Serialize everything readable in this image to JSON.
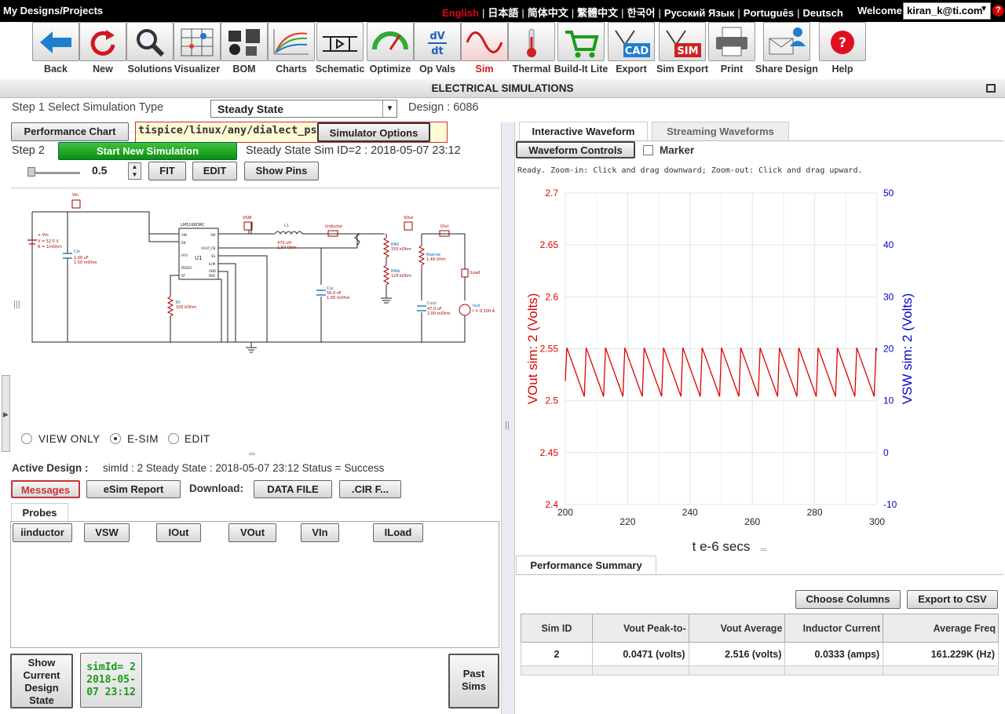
{
  "topbar": {
    "home": "My Designs/Projects",
    "languages": [
      "English",
      "日本語",
      "简体中文",
      "繁體中文",
      "한국어",
      "Русский Язык",
      "Português",
      "Deutsch"
    ],
    "welcome": "Welcome",
    "user": "kiran_k@ti.com",
    "help": "?"
  },
  "toolbar": [
    {
      "label": "Back",
      "icon": "back-arrow-icon"
    },
    {
      "label": "New",
      "icon": "refresh-icon"
    },
    {
      "label": "Solutions",
      "icon": "magnifier-icon"
    },
    {
      "label": "Visualizer",
      "icon": "visualizer-grid-icon"
    },
    {
      "label": "BOM",
      "icon": "bom-parts-icon"
    },
    {
      "label": "Charts",
      "icon": "charts-icon"
    },
    {
      "label": "Schematic",
      "icon": "schematic-icon"
    },
    {
      "label": "Optimize",
      "icon": "gauge-icon"
    },
    {
      "label": "Op Vals",
      "icon": "dv-dt-icon"
    },
    {
      "label": "Sim",
      "icon": "sine-wave-icon"
    },
    {
      "label": "Thermal",
      "icon": "thermometer-icon"
    },
    {
      "label": "Build-It Lite",
      "icon": "cart-icon"
    },
    {
      "label": "Export",
      "icon": "cad-export-icon"
    },
    {
      "label": "Sim Export",
      "icon": "sim-export-icon"
    },
    {
      "label": "Print",
      "icon": "printer-icon"
    },
    {
      "label": "Share Design",
      "icon": "share-envelope-icon"
    },
    {
      "label": "Help",
      "icon": "help-icon"
    }
  ],
  "section_title": "ELECTRICAL SIMULATIONS",
  "step1": {
    "label": "Step 1 Select Simulation Type",
    "selected": "Steady State",
    "design_label": "Design : 6086"
  },
  "left": {
    "perf_chart_btn": "Performance Chart",
    "path": "tispice/linux/any/dialect_pspice",
    "sim_options_btn": "Simulator Options",
    "step2_label": "Step 2",
    "start_btn": "Start New Simulation",
    "sim_id_text": "Steady State Sim ID=2 : 2018-05-07 23:12",
    "zoom_value": "0.5",
    "fit_btn": "FIT",
    "edit_btn": "EDIT",
    "show_pins_btn": "Show Pins",
    "modes": [
      "VIEW ONLY",
      "E-SIM",
      "EDIT"
    ],
    "active_design_label": "Active Design :",
    "active_design_value": "simId : 2 Steady State : 2018-05-07 23:12 Status = Success",
    "messages_btn": "Messages",
    "esim_report_btn": "eSim Report",
    "download_label": "Download:",
    "data_file_btn": "DATA FILE",
    "cir_btn": ".CIR F...",
    "probes_tab": "Probes",
    "probes": [
      "iinductor",
      "VSW",
      "IOut",
      "VOut",
      "VIn",
      "ILoad"
    ],
    "show_current_btn": "Show Current Design State",
    "sim_card": "simId= 2 2018-05-07 23:12",
    "past_sims_btn": "Past Sims"
  },
  "schematic": {
    "vin_label": "VIn",
    "vsw_label": "VSW",
    "vout_label": "VOut",
    "iout_label": "IOut",
    "iinductor_label": "iinductor",
    "iload_label": "ILoad",
    "ic_name": "LM5166DRC",
    "ic_ref": "U1",
    "vin_src": [
      "+ Vin",
      "V = 52.5 V",
      "R = 1mOhm"
    ],
    "cin": [
      "Cin",
      "1.00 uF",
      "1.50 mOhm"
    ],
    "l1": [
      "L1",
      "470 uH",
      "1.50 Ohm"
    ],
    "rfbt": [
      "Rfbt",
      "150 kOhm"
    ],
    "rfbb": [
      "Rfbb",
      "124 kOhm"
    ],
    "rsense": [
      "Rsense",
      "1.49 Ohm"
    ],
    "css": [
      "Css",
      "56.0 nF",
      "1.00 mOhm"
    ],
    "cout": [
      "Cout",
      "47.0 uF",
      "2.00 mOhm"
    ],
    "rt": [
      "Rt",
      "105 kOhm"
    ],
    "iout_src": [
      "Iout",
      "I = 0.100 A"
    ],
    "pins_left": [
      "VIN",
      "EN",
      "HYS",
      "PEDOC",
      "RT"
    ],
    "pins_right": [
      "SW",
      "VOUT_FB",
      "SS",
      "ILIM",
      "GND",
      "PAD"
    ]
  },
  "right": {
    "tabs": [
      "Interactive Waveform",
      "Streaming Waveforms"
    ],
    "waveform_controls_btn": "Waveform Controls",
    "marker_label": "Marker",
    "status": "Ready.  Zoom-in: Click and drag downward; Zoom-out: Click and drag upward.",
    "summary_tab": "Performance Summary",
    "choose_columns_btn": "Choose Columns",
    "export_csv_btn": "Export to CSV",
    "table": {
      "headers": [
        "Sim ID",
        "Vout Peak-to-",
        "Vout Average",
        "Inductor Current",
        "Average Freq"
      ],
      "rows": [
        [
          "2",
          "0.0471 (volts)",
          "2.516 (volts)",
          "0.0333 (amps)",
          "161.229K (Hz)"
        ]
      ]
    }
  },
  "chart_data": {
    "type": "line",
    "xlabel": "t e-6 secs",
    "ylabel": "VOut sim:  2 (Volts)",
    "y2label": "VSW sim:  2 (Volts)",
    "xlim": [
      200,
      300
    ],
    "ylim": [
      2.4,
      2.7
    ],
    "y2lim": [
      -10,
      50
    ],
    "xticks": [
      200,
      220,
      240,
      260,
      280,
      300
    ],
    "yticks": [
      2.4,
      2.45,
      2.5,
      2.55,
      2.6,
      2.65,
      2.7
    ],
    "y2ticks": [
      -10,
      0,
      10,
      20,
      30,
      40,
      50
    ],
    "series": [
      {
        "name": "VOut sim:  2 (Volts)",
        "color": "#e00000",
        "shape": "sawtooth",
        "period": 6.2,
        "phase": 200.5,
        "min": 2.504,
        "max": 2.551,
        "start": 2.519
      }
    ],
    "y2color": "#0000cc",
    "grid": true
  }
}
